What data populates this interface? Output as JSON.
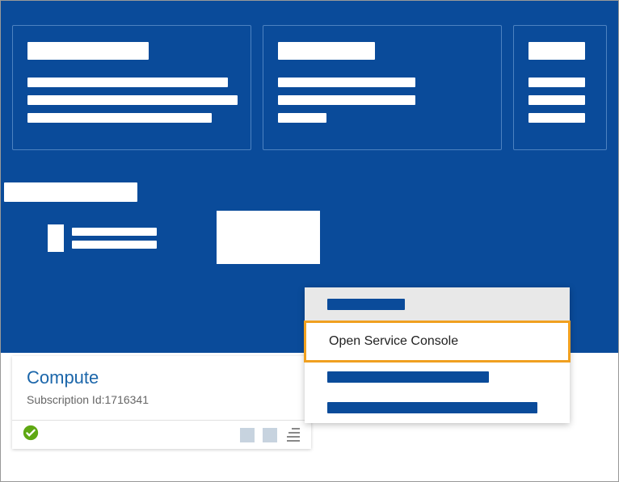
{
  "service": {
    "title": "Compute",
    "subscription_label": "Subscription Id:",
    "subscription_id": "1716341"
  },
  "context_menu": {
    "open_console": "Open Service Console"
  }
}
